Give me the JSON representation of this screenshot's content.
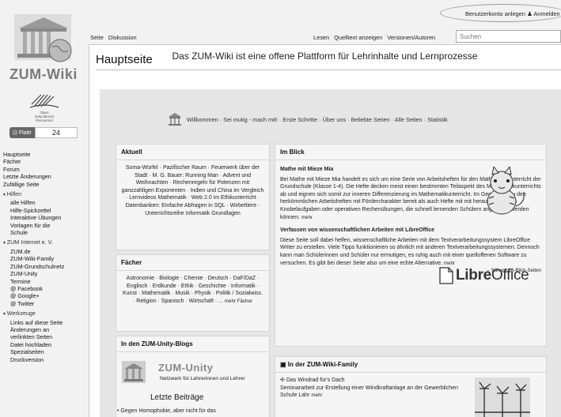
{
  "sidebar": {
    "logo_title": "ZUM-Wiki",
    "oer_text": "Open Educational Resources",
    "flattr_label": "Flattr",
    "flattr_count": "24",
    "items": [
      {
        "label": "Hauptseite",
        "type": "it"
      },
      {
        "label": "Fächer",
        "type": "it"
      },
      {
        "label": "Forum",
        "type": "it"
      },
      {
        "label": "Letzte Änderungen",
        "type": "it"
      },
      {
        "label": "Zufällige Seite",
        "type": "it"
      },
      {
        "label": "Hilfen",
        "type": "hd"
      },
      {
        "label": "alle Hilfen",
        "type": "ind"
      },
      {
        "label": "Hilfe-Spickzettel",
        "type": "ind"
      },
      {
        "label": "Interaktive Übungen",
        "type": "ind"
      },
      {
        "label": "Vorlagen für die",
        "type": "ind"
      },
      {
        "label": "Schule",
        "type": "ind"
      },
      {
        "label": "ZUM Internet e. V.",
        "type": "hd"
      },
      {
        "label": "ZUM.de",
        "type": "ind"
      },
      {
        "label": "ZUM-Wiki-Family",
        "type": "ind"
      },
      {
        "label": "ZUM-Grundschulnetz",
        "type": "ind"
      },
      {
        "label": "ZUM-Unity",
        "type": "ind"
      },
      {
        "label": "Termine",
        "type": "ind"
      },
      {
        "label": "@ Facebook",
        "type": "ind"
      },
      {
        "label": "@ Google+",
        "type": "ind"
      },
      {
        "label": "@ Twitter",
        "type": "ind"
      },
      {
        "label": "Werkzeuge",
        "type": "hd"
      },
      {
        "label": "Links auf diese Seite",
        "type": "ind"
      },
      {
        "label": "Änderungen an",
        "type": "ind"
      },
      {
        "label": "verlinkten Seiten",
        "type": "ind"
      },
      {
        "label": "Datei hochladen",
        "type": "ind"
      },
      {
        "label": "Spezialseiten",
        "type": "ind"
      },
      {
        "label": "Druckversion",
        "type": "ind"
      }
    ]
  },
  "header": {
    "create_account": "Benutzerkonto anlegen",
    "login": "Anmelden",
    "tab_page": "Seite",
    "tab_discussion": "Diskussion",
    "tab_read": "Lesen",
    "tab_source": "Quelltext anzeigen",
    "tab_history": "Versionen/Autoren",
    "search_placeholder": "Suchen"
  },
  "main": {
    "page_title": "Hauptseite",
    "hero_title": "Das ZUM-Wiki ist eine offene Plattform für Lehrinhalte und Lernprozesse",
    "hero_links": "Willkommen · Sei mutig - mach mit! · Erste Schritte · Über uns · Beliebte Seiten · Alle Seiten · Statistik",
    "aktuell_title": "Aktuell",
    "aktuell_text": "Soma-Würfel · Pazifischer Raum · Feuerwerk über der Stadt · M. G. Bauer: Running Man · Advent und Weihnachten · Rechenregeln für Potenzen mit ganzzahligen Exponenten · Indien und China im Vergleich · Lernvideos Mathematik · Web 2.0 im Ethikunterricht · Datenbanken: Einfache Abfragen in SQL · Wirbeltiere · Unterrichtsreihe Informatik Grundlagen",
    "faecher_title": "Fächer",
    "faecher_text": "Astronomie · Biologie · Chemie · Deutsch · DaF/DaZ · Englisch · Erdkunde · Ethik · Geschichte · Informatik · Kunst · Mathematik · Musik · Physik · Politik / Sozialwiss. · Religion · Spanisch · Wirtschaft · ...",
    "faecher_more": "mehr Fächer",
    "blogs_title_pre": "In den",
    "blogs_title_link": "ZUM-Unity-Blogs",
    "unity_logo": "ZUM-Unity",
    "unity_sub": "Netzwerk für Lehrerinnen und Lehrer",
    "letzte_title": "Letzte Beiträge",
    "blog_item1": "• Gegen Homophobie, aber nicht für das",
    "imblick_title": "Im Blick",
    "mathe_title": "Mathe mit Mieze Mia",
    "mathe_text": "Bei Mathe mit Mieze Mia handelt es sich um eine Serie von Arbeitsheften für den Mathematikunterricht der Grundschule (Klasse 1-4). Die Hefte decken meist einen bestimmten Teilaspekt des Mathematikunterrichts ab und eignen sich somit zur inneren Differenzierung im Mathematikunterricht. Im Gegensatz zu den herkömmlichen Arbeitsheften mit Fördercharakter bereit als auch Hefte mit mit herausfordernden Knobelaufgaben oder operativen Rechenübungen, die schnell lernenden Schülern angeboten werden können.",
    "mathe_more": "mehr",
    "libre_title": "Verfassen von wissenschaftlichen Arbeiten mit LibreOffice",
    "libre_text": "Diese Seite soll dabei helfen, wissenschaftliche Arbeiten mit dem Textverarbeitungssystem LibreOffice Writer zu erstellen. Viele Tipps funktionieren so ähnlich mit anderen Textverarbeitungssystemen. Dennoch kann man Schülerinnen und Schüler nur ermutigen, es ruhig auch mit einer quelloffenen Software zu versuchen. Es gibt bei dieser Seite also um eine echte Alternative.",
    "libre_more": "mehr",
    "libre_logo_a": "Libre",
    "libre_logo_b": "Office",
    "blick_archive": "→ frühere Im-Blick-Seiten",
    "family_title_pre": "In der",
    "family_title_link": "ZUM-Wiki-Family",
    "wind_title": "Das Windrad für's Dach",
    "wind_text": "Seminararbeit zur Erstellung einer Windkraftanlage an der Gewerblichen Schule Lahr",
    "wind_more": "mehr"
  }
}
